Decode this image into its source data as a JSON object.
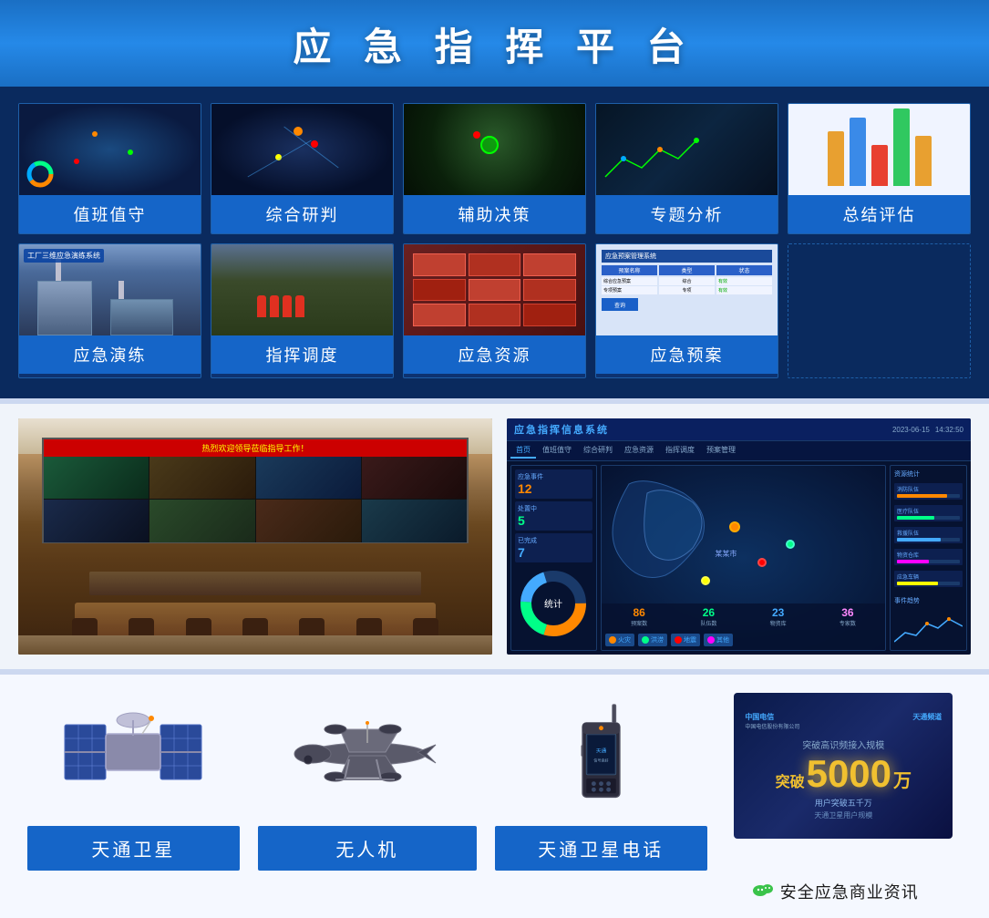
{
  "header": {
    "title": "应 急 指 挥 平 台"
  },
  "modules_row1": [
    {
      "id": "zhibanzishou",
      "label": "值班值守",
      "img_class": "img-zhibanzishou"
    },
    {
      "id": "zongheyanjuan",
      "label": "综合研判",
      "img_class": "img-zongheyanjuan"
    },
    {
      "id": "fuzhujuece",
      "label": "辅助决策",
      "img_class": "img-fuzhujuece"
    },
    {
      "id": "zhuantifenxi",
      "label": "专题分析",
      "img_class": "img-zhuantifenxi"
    },
    {
      "id": "zongjiepigu",
      "label": "总结评估",
      "img_class": "img-zongjiepigu"
    }
  ],
  "modules_row2": [
    {
      "id": "yingjiyanlian",
      "label": "应急演练",
      "img_class": "img-yingjiyanlian"
    },
    {
      "id": "zhihuidiaodu",
      "label": "指挥调度",
      "img_class": "img-zhihuidiaodu"
    },
    {
      "id": "yingjiziyuan",
      "label": "应急资源",
      "img_class": "img-yingjiziyuan"
    },
    {
      "id": "yingjiyuan",
      "label": "应急预案",
      "img_class": "img-yingjiyuan"
    }
  ],
  "command": {
    "room_text": "热烈欢迎领导莅临指导工作！",
    "dashboard_title": "应急指挥信息系统"
  },
  "equipment": [
    {
      "id": "satellite",
      "label": "天通卫星"
    },
    {
      "id": "drone",
      "label": "无人机"
    },
    {
      "id": "phone",
      "label": "天通卫星电话"
    }
  ],
  "promo": {
    "logo1": "中国电信",
    "logo2": "天通频道",
    "headline": "突破高识频接入规模",
    "number": "5000",
    "unit": "万",
    "prefix": "突破",
    "sub": "用户突破五千万",
    "desc": "天通卫星用户规模"
  },
  "wechat": {
    "label": "安全应急商业资讯",
    "icon": "●"
  }
}
